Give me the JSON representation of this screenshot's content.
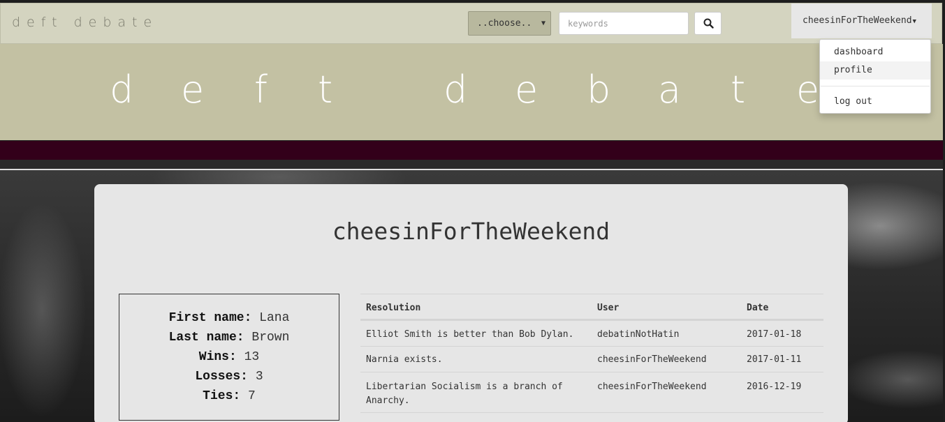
{
  "navbar": {
    "brand": "deft debate",
    "select_value": "..choose..",
    "search_placeholder": "keywords",
    "user_menu_label": "cheesinForTheWeekend"
  },
  "dropdown": {
    "items": [
      "dashboard",
      "profile",
      "log out"
    ],
    "active": "profile"
  },
  "banner": {
    "letters": [
      "d",
      "e",
      "f",
      "t",
      "d",
      "e",
      "b",
      "a",
      "t",
      "e"
    ]
  },
  "profile": {
    "username": "cheesinForTheWeekend",
    "first_name_label": "First name:",
    "first_name": "Lana",
    "last_name_label": "Last name:",
    "last_name": "Brown",
    "wins_label": "Wins:",
    "wins": "13",
    "losses_label": "Losses:",
    "losses": "3",
    "ties_label": "Ties:",
    "ties": "7"
  },
  "debates_table": {
    "headers": [
      "Resolution",
      "User",
      "Date"
    ],
    "rows": [
      [
        "Elliot Smith is better than Bob Dylan.",
        "debatinNotHatin",
        "2017-01-18"
      ],
      [
        "Narnia exists.",
        "cheesinForTheWeekend",
        "2017-01-11"
      ],
      [
        "Libertarian Socialism is a branch of Anarchy.",
        "cheesinForTheWeekend",
        "2016-12-19"
      ]
    ]
  },
  "colors": {
    "navbar_bg": "#d4d4c0",
    "banner_bg": "#c3c1a3",
    "accent_maroon": "#33001a",
    "card_bg": "#e6e6e6"
  }
}
